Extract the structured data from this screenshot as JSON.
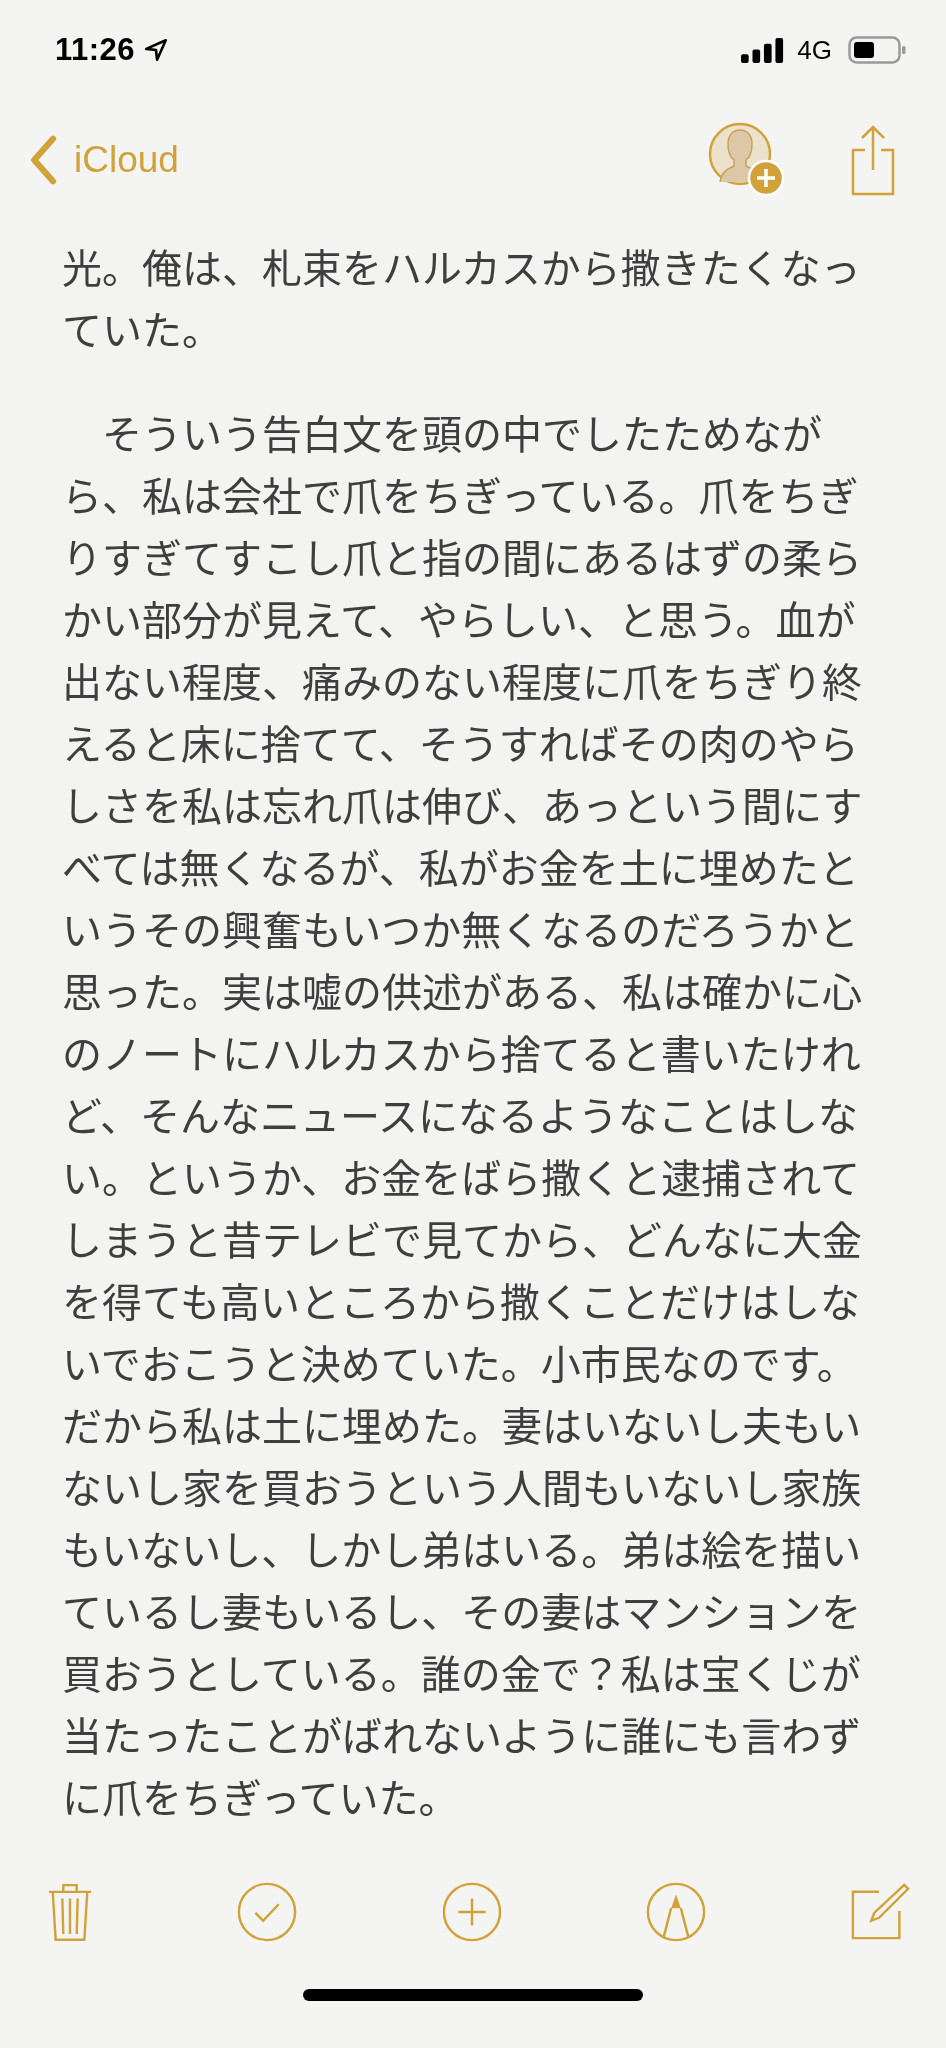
{
  "status_bar": {
    "time": "11:26",
    "network": "4G"
  },
  "nav_bar": {
    "back_label": "iCloud"
  },
  "note": {
    "paragraphs": [
      "光。俺は、札束をハルカスから撒きたくなっていた。",
      "　そういう告白文を頭の中でしたためながら、私は会社で爪をちぎっている。爪をちぎりすぎてすこし爪と指の間にあるはずの柔らかい部分が見えて、やらしい、と思う。血が出ない程度、痛みのない程度に爪をちぎり終えると床に捨てて、そうすればその肉のやらしさを私は忘れ爪は伸び、あっという間にすべては無くなるが、私がお金を土に埋めたというその興奮もいつか無くなるのだろうかと思った。実は嘘の供述がある、私は確かに心のノートにハルカスから捨てると書いたけれど、そんなニュースになるようなことはしない。というか、お金をばら撒くと逮捕されてしまうと昔テレビで見てから、どんなに大金を得ても高いところから撒くことだけはしないでおこうと決めていた。小市民なのです。だから私は土に埋めた。妻はいないし夫もいないし家を買おうという人間もいないし家族もいないし、しかし弟はいる。弟は絵を描いているし妻もいるし、その妻はマンションを買おうとしている。誰の金で？私は宝くじが当たったことがばれないように誰にも言わずに爪をちぎっていた。"
    ]
  }
}
